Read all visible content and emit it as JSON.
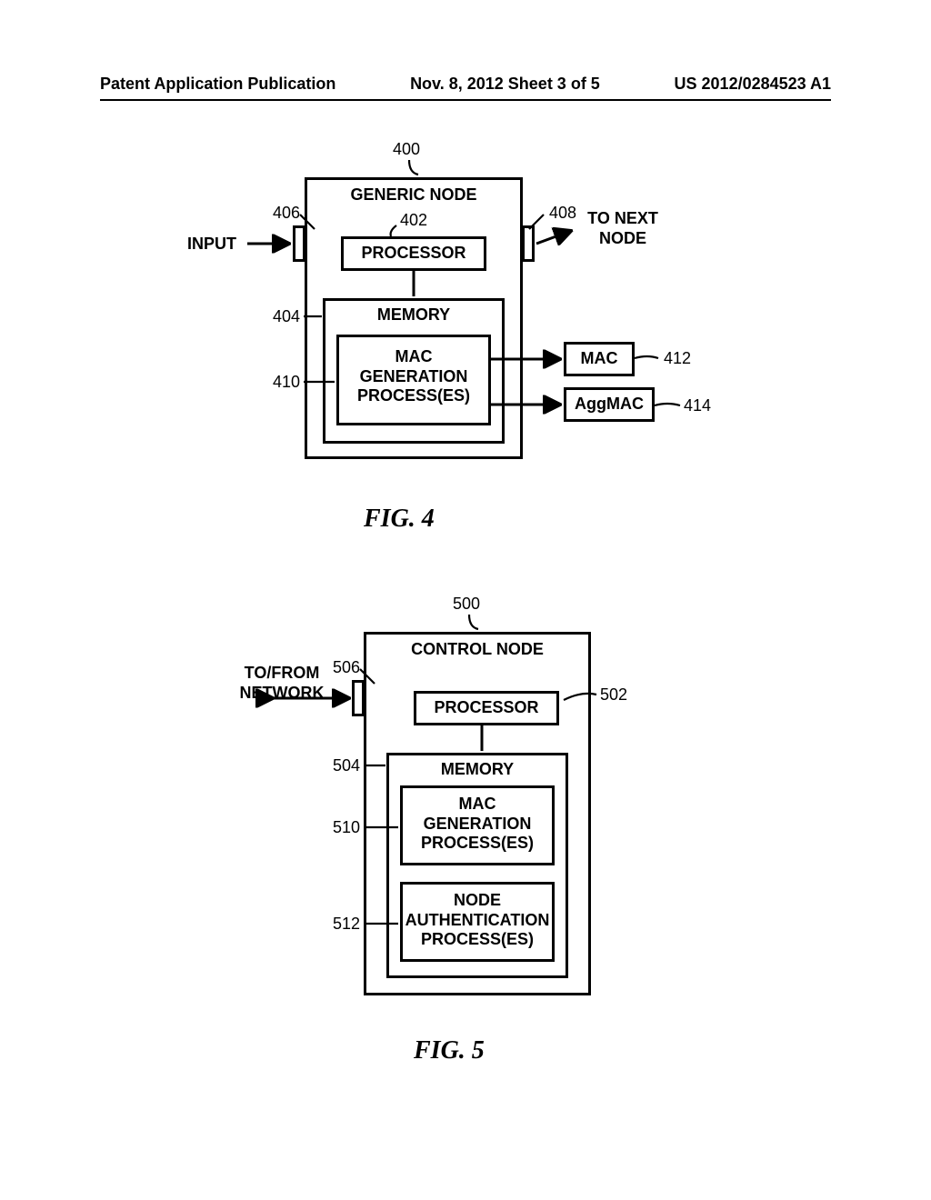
{
  "header": {
    "left": "Patent Application Publication",
    "mid": "Nov. 8, 2012  Sheet 3 of 5",
    "right": "US 2012/0284523 A1"
  },
  "fig4": {
    "title": "GENERIC NODE",
    "processor": "PROCESSOR",
    "memory": "MEMORY",
    "macgen": "MAC\nGENERATION\nPROCESS(ES)",
    "mac": "MAC",
    "aggmac": "AggMAC",
    "input": "INPUT",
    "tonext": "TO NEXT\nNODE",
    "caption": "FIG.  4",
    "refs": {
      "r400": "400",
      "r402": "402",
      "r404": "404",
      "r406": "406",
      "r408": "408",
      "r410": "410",
      "r412": "412",
      "r414": "414"
    }
  },
  "fig5": {
    "title": "CONTROL NODE",
    "processor": "PROCESSOR",
    "memory": "MEMORY",
    "macgen": "MAC\nGENERATION\nPROCESS(ES)",
    "nodeauth": "NODE\nAUTHENTICATION\nPROCESS(ES)",
    "tofrom": "TO/FROM\nNETWORK",
    "caption": "FIG.  5",
    "refs": {
      "r500": "500",
      "r502": "502",
      "r504": "504",
      "r506": "506",
      "r510": "510",
      "r512": "512"
    }
  }
}
